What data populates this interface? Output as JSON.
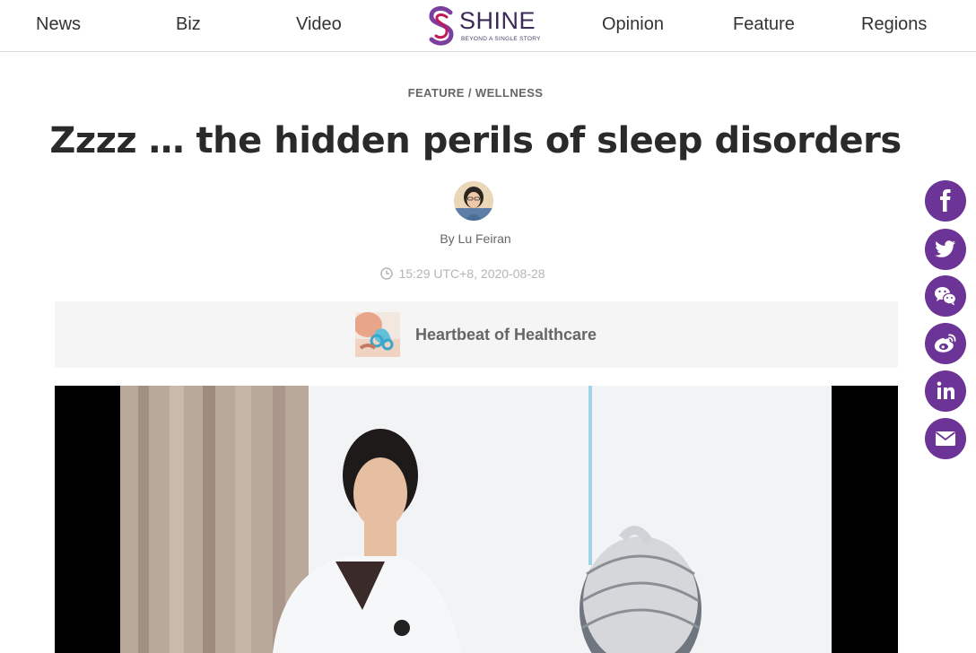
{
  "nav": {
    "left": [
      "News",
      "Biz",
      "Video"
    ],
    "right": [
      "Opinion",
      "Feature",
      "Regions"
    ],
    "logo": {
      "word": "SHINE",
      "tagline": "BEYOND A SINGLE STORY"
    }
  },
  "article": {
    "kicker": {
      "section": "FEATURE",
      "separator": " / ",
      "subsection": "WELLNESS"
    },
    "title": "Zzzz … the hidden perils of sleep disorders",
    "byline": "By Lu Feiran",
    "timestamp": "15:29 UTC+8, 2020-08-28"
  },
  "series": {
    "label": "Heartbeat of Healthcare"
  },
  "share": {
    "icons": [
      "facebook-icon",
      "twitter-icon",
      "wechat-icon",
      "weibo-icon",
      "linkedin-icon",
      "email-icon"
    ],
    "color": "#6b3496"
  },
  "colors": {
    "brand": "#3a2b57",
    "share_button": "#6b3496",
    "nav_text": "#333333"
  }
}
